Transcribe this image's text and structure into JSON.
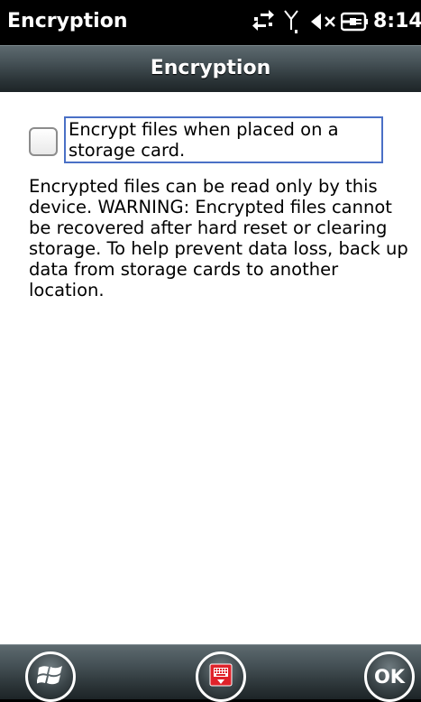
{
  "status_bar": {
    "app_title": "Encryption",
    "time": "8:14",
    "icons": [
      "connectivity-arrows-icon",
      "antenna-signal-icon",
      "volume-muted-icon",
      "battery-charging-icon"
    ]
  },
  "title_bar": {
    "title": "Encryption"
  },
  "content": {
    "checkbox_label": "Encrypt files when placed on a storage card.",
    "checkbox_checked": false,
    "warning_text": "Encrypted files can be read only by this device. WARNING: Encrypted files cannot be recovered after hard reset or clearing storage. To help prevent data loss, back up data from storage cards to another location."
  },
  "bottom_bar": {
    "start_icon": "windows-start-icon",
    "keyboard_icon": "keyboard-icon",
    "ok_label": "OK"
  },
  "colors": {
    "focus_border": "#4a70c6",
    "keyboard_red": "#e0222a"
  }
}
